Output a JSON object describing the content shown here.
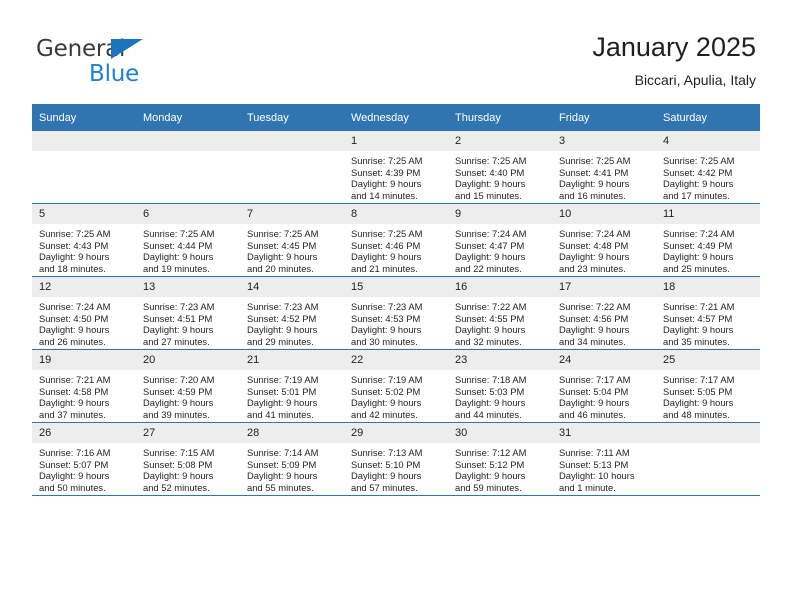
{
  "brand": {
    "name_top": "General",
    "name_bottom": "Blue",
    "triangle_color": "#1c75bc",
    "top_color": "#3b3b3b",
    "bottom_color": "#1c83d4"
  },
  "header": {
    "title": "January 2025",
    "subtitle": "Biccari, Apulia, Italy"
  },
  "colors": {
    "header_row": "#3175b0",
    "daynum_band": "#ededed",
    "grid_line": "#3175b0",
    "text": "#231f20"
  },
  "weekdays": [
    "Sunday",
    "Monday",
    "Tuesday",
    "Wednesday",
    "Thursday",
    "Friday",
    "Saturday"
  ],
  "weeks": [
    [
      {
        "day": "",
        "empty": true,
        "lines": []
      },
      {
        "day": "",
        "empty": true,
        "lines": []
      },
      {
        "day": "",
        "empty": true,
        "lines": []
      },
      {
        "day": "1",
        "lines": [
          "Sunrise: 7:25 AM",
          "Sunset: 4:39 PM",
          "Daylight: 9 hours",
          "and 14 minutes."
        ]
      },
      {
        "day": "2",
        "lines": [
          "Sunrise: 7:25 AM",
          "Sunset: 4:40 PM",
          "Daylight: 9 hours",
          "and 15 minutes."
        ]
      },
      {
        "day": "3",
        "lines": [
          "Sunrise: 7:25 AM",
          "Sunset: 4:41 PM",
          "Daylight: 9 hours",
          "and 16 minutes."
        ]
      },
      {
        "day": "4",
        "lines": [
          "Sunrise: 7:25 AM",
          "Sunset: 4:42 PM",
          "Daylight: 9 hours",
          "and 17 minutes."
        ]
      }
    ],
    [
      {
        "day": "5",
        "lines": [
          "Sunrise: 7:25 AM",
          "Sunset: 4:43 PM",
          "Daylight: 9 hours",
          "and 18 minutes."
        ]
      },
      {
        "day": "6",
        "lines": [
          "Sunrise: 7:25 AM",
          "Sunset: 4:44 PM",
          "Daylight: 9 hours",
          "and 19 minutes."
        ]
      },
      {
        "day": "7",
        "lines": [
          "Sunrise: 7:25 AM",
          "Sunset: 4:45 PM",
          "Daylight: 9 hours",
          "and 20 minutes."
        ]
      },
      {
        "day": "8",
        "lines": [
          "Sunrise: 7:25 AM",
          "Sunset: 4:46 PM",
          "Daylight: 9 hours",
          "and 21 minutes."
        ]
      },
      {
        "day": "9",
        "lines": [
          "Sunrise: 7:24 AM",
          "Sunset: 4:47 PM",
          "Daylight: 9 hours",
          "and 22 minutes."
        ]
      },
      {
        "day": "10",
        "lines": [
          "Sunrise: 7:24 AM",
          "Sunset: 4:48 PM",
          "Daylight: 9 hours",
          "and 23 minutes."
        ]
      },
      {
        "day": "11",
        "lines": [
          "Sunrise: 7:24 AM",
          "Sunset: 4:49 PM",
          "Daylight: 9 hours",
          "and 25 minutes."
        ]
      }
    ],
    [
      {
        "day": "12",
        "lines": [
          "Sunrise: 7:24 AM",
          "Sunset: 4:50 PM",
          "Daylight: 9 hours",
          "and 26 minutes."
        ]
      },
      {
        "day": "13",
        "lines": [
          "Sunrise: 7:23 AM",
          "Sunset: 4:51 PM",
          "Daylight: 9 hours",
          "and 27 minutes."
        ]
      },
      {
        "day": "14",
        "lines": [
          "Sunrise: 7:23 AM",
          "Sunset: 4:52 PM",
          "Daylight: 9 hours",
          "and 29 minutes."
        ]
      },
      {
        "day": "15",
        "lines": [
          "Sunrise: 7:23 AM",
          "Sunset: 4:53 PM",
          "Daylight: 9 hours",
          "and 30 minutes."
        ]
      },
      {
        "day": "16",
        "lines": [
          "Sunrise: 7:22 AM",
          "Sunset: 4:55 PM",
          "Daylight: 9 hours",
          "and 32 minutes."
        ]
      },
      {
        "day": "17",
        "lines": [
          "Sunrise: 7:22 AM",
          "Sunset: 4:56 PM",
          "Daylight: 9 hours",
          "and 34 minutes."
        ]
      },
      {
        "day": "18",
        "lines": [
          "Sunrise: 7:21 AM",
          "Sunset: 4:57 PM",
          "Daylight: 9 hours",
          "and 35 minutes."
        ]
      }
    ],
    [
      {
        "day": "19",
        "lines": [
          "Sunrise: 7:21 AM",
          "Sunset: 4:58 PM",
          "Daylight: 9 hours",
          "and 37 minutes."
        ]
      },
      {
        "day": "20",
        "lines": [
          "Sunrise: 7:20 AM",
          "Sunset: 4:59 PM",
          "Daylight: 9 hours",
          "and 39 minutes."
        ]
      },
      {
        "day": "21",
        "lines": [
          "Sunrise: 7:19 AM",
          "Sunset: 5:01 PM",
          "Daylight: 9 hours",
          "and 41 minutes."
        ]
      },
      {
        "day": "22",
        "lines": [
          "Sunrise: 7:19 AM",
          "Sunset: 5:02 PM",
          "Daylight: 9 hours",
          "and 42 minutes."
        ]
      },
      {
        "day": "23",
        "lines": [
          "Sunrise: 7:18 AM",
          "Sunset: 5:03 PM",
          "Daylight: 9 hours",
          "and 44 minutes."
        ]
      },
      {
        "day": "24",
        "lines": [
          "Sunrise: 7:17 AM",
          "Sunset: 5:04 PM",
          "Daylight: 9 hours",
          "and 46 minutes."
        ]
      },
      {
        "day": "25",
        "lines": [
          "Sunrise: 7:17 AM",
          "Sunset: 5:05 PM",
          "Daylight: 9 hours",
          "and 48 minutes."
        ]
      }
    ],
    [
      {
        "day": "26",
        "lines": [
          "Sunrise: 7:16 AM",
          "Sunset: 5:07 PM",
          "Daylight: 9 hours",
          "and 50 minutes."
        ]
      },
      {
        "day": "27",
        "lines": [
          "Sunrise: 7:15 AM",
          "Sunset: 5:08 PM",
          "Daylight: 9 hours",
          "and 52 minutes."
        ]
      },
      {
        "day": "28",
        "lines": [
          "Sunrise: 7:14 AM",
          "Sunset: 5:09 PM",
          "Daylight: 9 hours",
          "and 55 minutes."
        ]
      },
      {
        "day": "29",
        "lines": [
          "Sunrise: 7:13 AM",
          "Sunset: 5:10 PM",
          "Daylight: 9 hours",
          "and 57 minutes."
        ]
      },
      {
        "day": "30",
        "lines": [
          "Sunrise: 7:12 AM",
          "Sunset: 5:12 PM",
          "Daylight: 9 hours",
          "and 59 minutes."
        ]
      },
      {
        "day": "31",
        "lines": [
          "Sunrise: 7:11 AM",
          "Sunset: 5:13 PM",
          "Daylight: 10 hours",
          "and 1 minute."
        ]
      },
      {
        "day": "",
        "empty": true,
        "lines": []
      }
    ]
  ]
}
